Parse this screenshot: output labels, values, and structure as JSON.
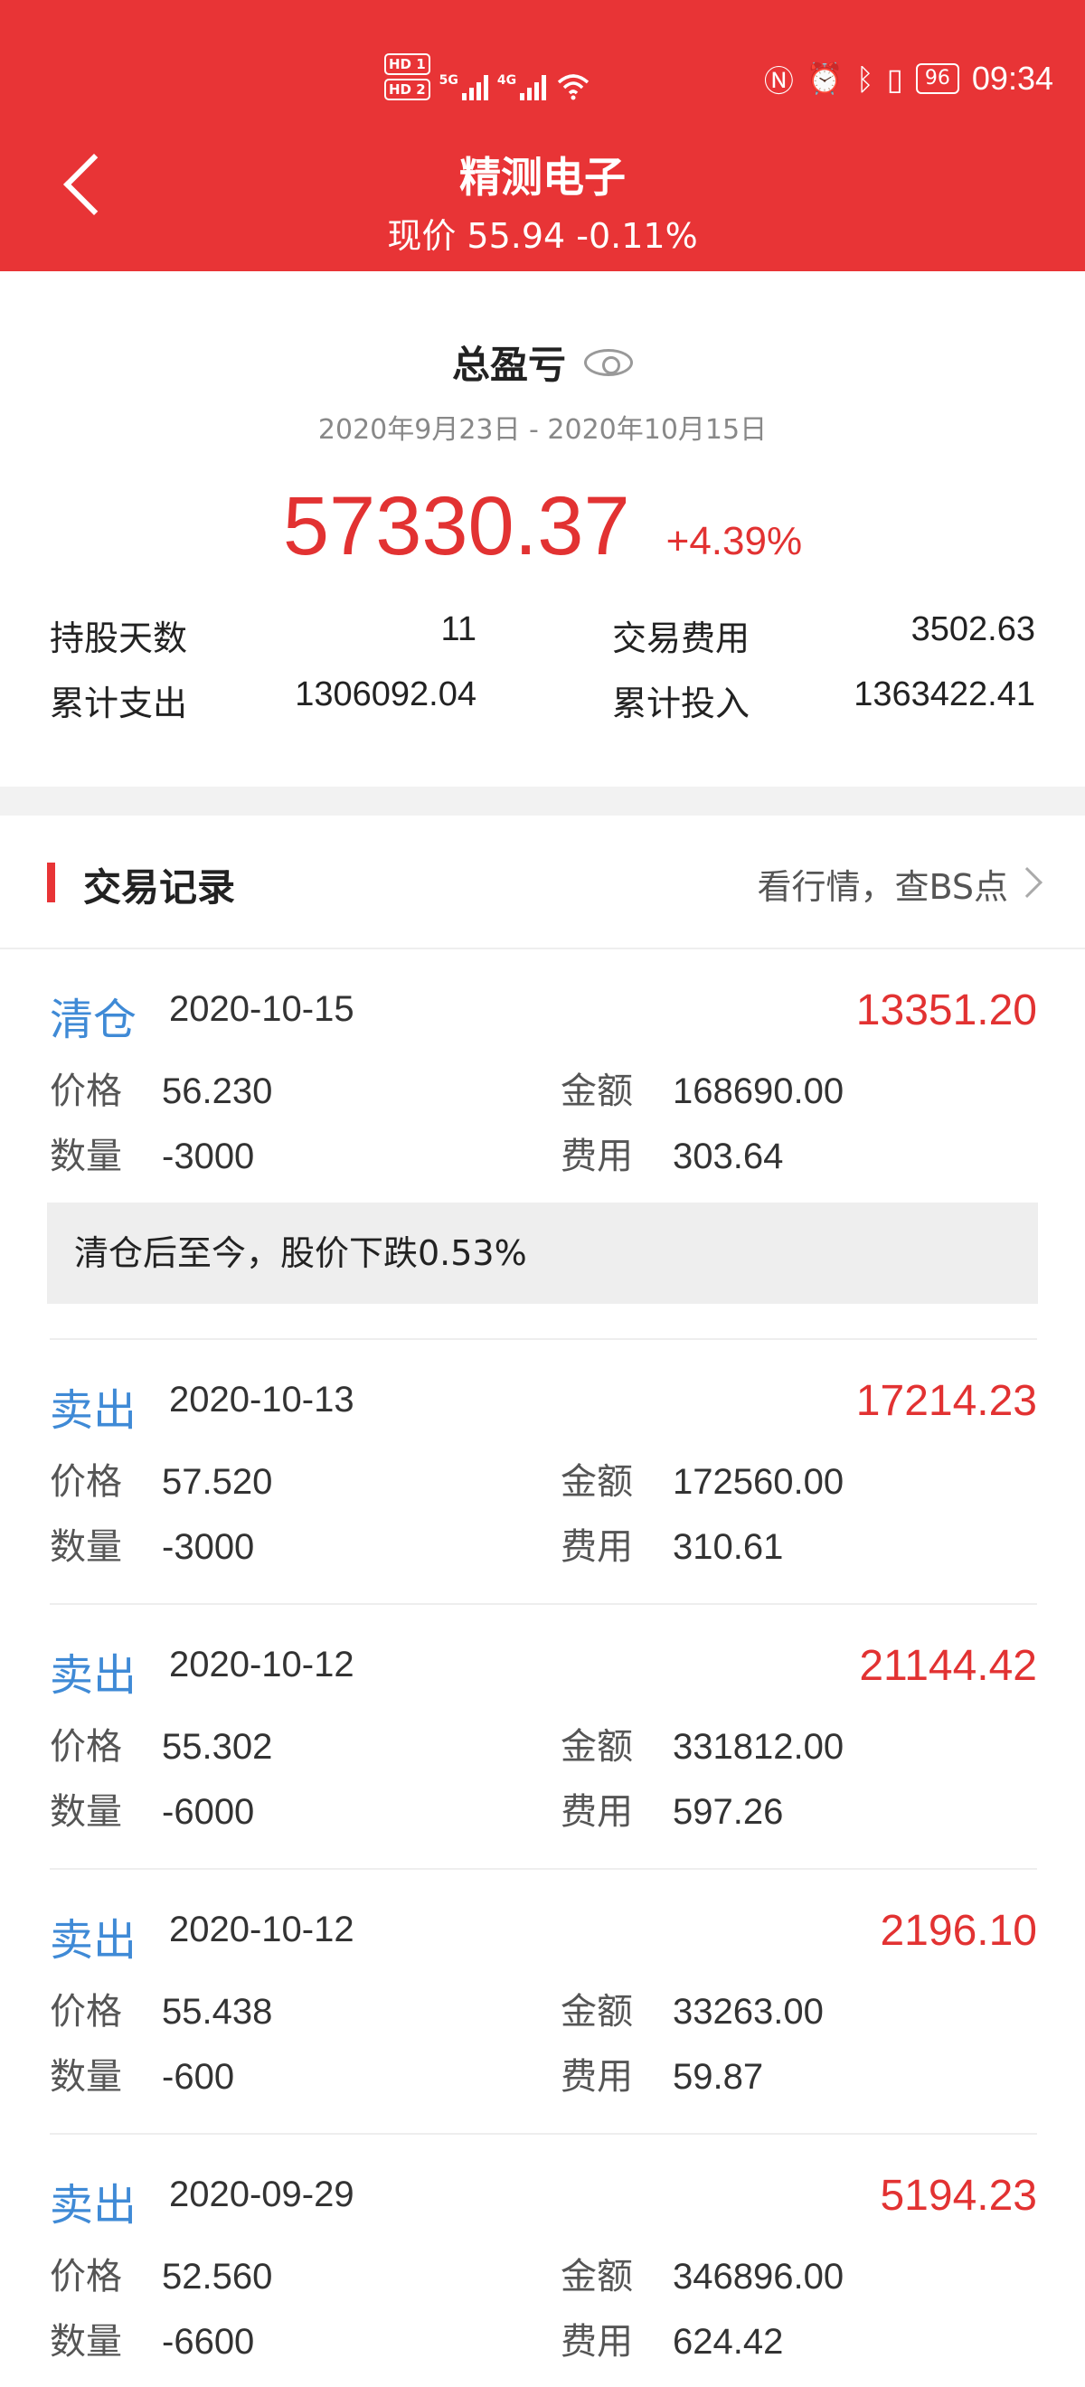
{
  "status_bar": {
    "hd1": "HD 1",
    "hd2": "HD 2",
    "net1": "5G",
    "net2": "4G",
    "battery": "96",
    "time": "09:34"
  },
  "header": {
    "title": "精测电子",
    "subtitle": "现价 55.94 -0.11%"
  },
  "summary": {
    "label": "总盈亏",
    "date_range": "2020年9月23日 - 2020年10月15日",
    "total_pl": "57330.37",
    "total_pl_pct": "+4.39%",
    "stats": {
      "hold_days_label": "持股天数",
      "hold_days": "11",
      "fee_label": "交易费用",
      "fee": "3502.63",
      "expense_label": "累计支出",
      "expense": "1306092.04",
      "invest_label": "累计投入",
      "invest": "1363422.41"
    }
  },
  "records": {
    "title": "交易记录",
    "link": "看行情，查BS点",
    "labels": {
      "price": "价格",
      "amount": "金额",
      "qty": "数量",
      "fee": "费用"
    },
    "items": [
      {
        "type": "清仓",
        "date": "2020-10-15",
        "profit": "13351.20",
        "price": "56.230",
        "amount": "168690.00",
        "qty": "-3000",
        "fee": "303.64",
        "note": "清仓后至今，股价下跌0.53%"
      },
      {
        "type": "卖出",
        "date": "2020-10-13",
        "profit": "17214.23",
        "price": "57.520",
        "amount": "172560.00",
        "qty": "-3000",
        "fee": "310.61"
      },
      {
        "type": "卖出",
        "date": "2020-10-12",
        "profit": "21144.42",
        "price": "55.302",
        "amount": "331812.00",
        "qty": "-6000",
        "fee": "597.26"
      },
      {
        "type": "卖出",
        "date": "2020-10-12",
        "profit": "2196.10",
        "price": "55.438",
        "amount": "33263.00",
        "qty": "-600",
        "fee": "59.87"
      },
      {
        "type": "卖出",
        "date": "2020-09-29",
        "profit": "5194.23",
        "price": "52.560",
        "amount": "346896.00",
        "qty": "-6600",
        "fee": "624.42"
      }
    ]
  },
  "colors": {
    "brand_red": "#e83436",
    "profit_red": "#e23232",
    "type_blue": "#3f8ad6"
  }
}
